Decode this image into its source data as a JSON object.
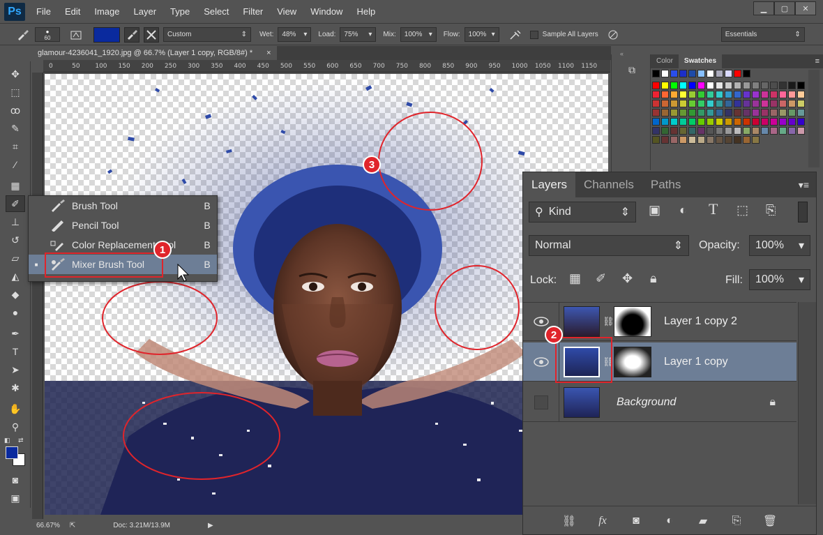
{
  "app": {
    "logo": "Ps",
    "menu": [
      "File",
      "Edit",
      "Image",
      "Layer",
      "Type",
      "Select",
      "Filter",
      "View",
      "Window",
      "Help"
    ],
    "window_controls": [
      "minimize-icon",
      "maximize-icon",
      "close-icon"
    ]
  },
  "options_bar": {
    "brush_size": "60",
    "foreground_color": "#0a2a9e",
    "preset": "Custom",
    "wet_label": "Wet:",
    "wet_value": "48%",
    "load_label": "Load:",
    "load_value": "75%",
    "mix_label": "Mix:",
    "mix_value": "100%",
    "flow_label": "Flow:",
    "flow_value": "100%",
    "sample_all_layers": "Sample All Layers",
    "workspace": "Essentials"
  },
  "document": {
    "tab_title": "glamour-4236041_1920.jpg @ 66.7% (Layer 1 copy, RGB/8#) *",
    "close": "×",
    "ruler_ticks": [
      "0",
      "50",
      "100",
      "150",
      "200",
      "250",
      "300",
      "350",
      "400",
      "450",
      "500",
      "550",
      "600",
      "650",
      "700",
      "750",
      "800",
      "850",
      "900",
      "950",
      "1000",
      "1050",
      "1100",
      "1150"
    ],
    "zoom": "66.67%",
    "doc_size": "Doc: 3.21M/13.9M"
  },
  "tool_flyout": {
    "items": [
      {
        "label": "Brush Tool",
        "key": "B",
        "icon": "brush-icon"
      },
      {
        "label": "Pencil Tool",
        "key": "B",
        "icon": "pencil-icon"
      },
      {
        "label": "Color Replacement Tool",
        "key": "B",
        "icon": "color-replacement-icon"
      },
      {
        "label": "Mixer Brush Tool",
        "key": "B",
        "icon": "mixer-brush-icon"
      }
    ],
    "bullet": "■"
  },
  "swatches_panel": {
    "tabs": [
      "Color",
      "Swatches"
    ]
  },
  "layers_panel": {
    "tabs": [
      "Layers",
      "Channels",
      "Paths"
    ],
    "filter_kind": "Kind",
    "blend_mode": "Normal",
    "opacity_label": "Opacity:",
    "opacity_value": "100%",
    "lock_label": "Lock:",
    "fill_label": "Fill:",
    "fill_value": "100%",
    "layers": [
      {
        "name": "Layer 1 copy 2",
        "visible": true
      },
      {
        "name": "Layer 1 copy",
        "visible": true,
        "selected": true
      },
      {
        "name": "Background",
        "visible": false,
        "locked": true
      }
    ]
  },
  "annotations": [
    "1",
    "2",
    "3"
  ],
  "colors": {
    "annotation_red": "#e0242b",
    "selection_blue": "#6d7e96",
    "panel_bg": "#535353"
  }
}
